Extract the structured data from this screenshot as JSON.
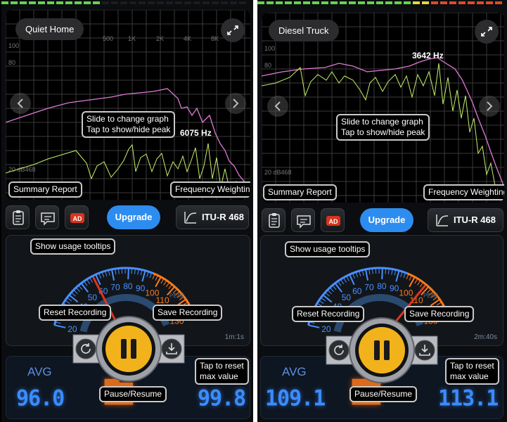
{
  "screens": [
    {
      "location": "Quiet Home",
      "grid_x_labels": [
        "500",
        "1K",
        "2K",
        "4K",
        "8K"
      ],
      "grid_y_labels": [
        "100",
        "80",
        "20 dB468"
      ],
      "peak_label": "6075 Hz",
      "tooltips": {
        "slide": "Slide to change graph",
        "tap_peak": "Tap to show/hide peak",
        "summary": "Summary Report",
        "weighting": "Frequency Weighting",
        "usage": "Show usage tooltips",
        "reset": "Reset Recording",
        "save": "Save Recording",
        "pause": "Pause/Resume",
        "tap_reset": "Tap to reset",
        "max_value": "max value"
      },
      "upgrade_label": "Upgrade",
      "weighting_label": "ITU-R 468",
      "ad_badge": "AD",
      "meter_scale": [
        "20",
        "30",
        "40",
        "50",
        "60",
        "70",
        "80",
        "90",
        "100",
        "110",
        "120",
        "130"
      ],
      "meter_sub_labels": {
        "peak": "PEAK"
      },
      "needle_value": 58,
      "elapsed": "1m:1s",
      "avg_label": "AVG",
      "avg_value": "96.0",
      "max_value": "99.8"
    },
    {
      "location": "Diesel Truck",
      "grid_x_labels": [
        "500",
        "1K",
        "2K",
        "4K",
        "8K"
      ],
      "grid_y_labels": [
        "100",
        "80",
        "20 dB468"
      ],
      "peak_label": "3642 Hz",
      "tooltips": {
        "slide": "Slide to change graph",
        "tap_peak": "Tap to show/hide peak",
        "summary": "Summary Report",
        "weighting": "Frequency Weighting",
        "usage": "Show usage tooltips",
        "reset": "Reset Recording",
        "save": "Save Recording",
        "pause": "Pause/Resume",
        "tap_reset": "Tap to reset",
        "max_value": "max value"
      },
      "upgrade_label": "Upgrade",
      "weighting_label": "ITU-R 468",
      "ad_badge": "AD",
      "meter_scale": [
        "20",
        "30",
        "40",
        "50",
        "60",
        "70",
        "80",
        "90",
        "100",
        "110",
        "120",
        "130"
      ],
      "meter_sub_labels": {
        "peak": "PEAK"
      },
      "needle_value": 108,
      "elapsed": "2m:40s",
      "avg_label": "AVG",
      "avg_value": "109.1",
      "max_value": "113.1"
    }
  ],
  "colors": {
    "upgrade": "#2d8cf0",
    "meter_blue": "#4a90ff",
    "meter_orange": "#ff7a1a",
    "pause_gold": "#f2b21b",
    "spectrum_pink": "#e07ad6",
    "spectrum_green": "#c6f06a"
  }
}
